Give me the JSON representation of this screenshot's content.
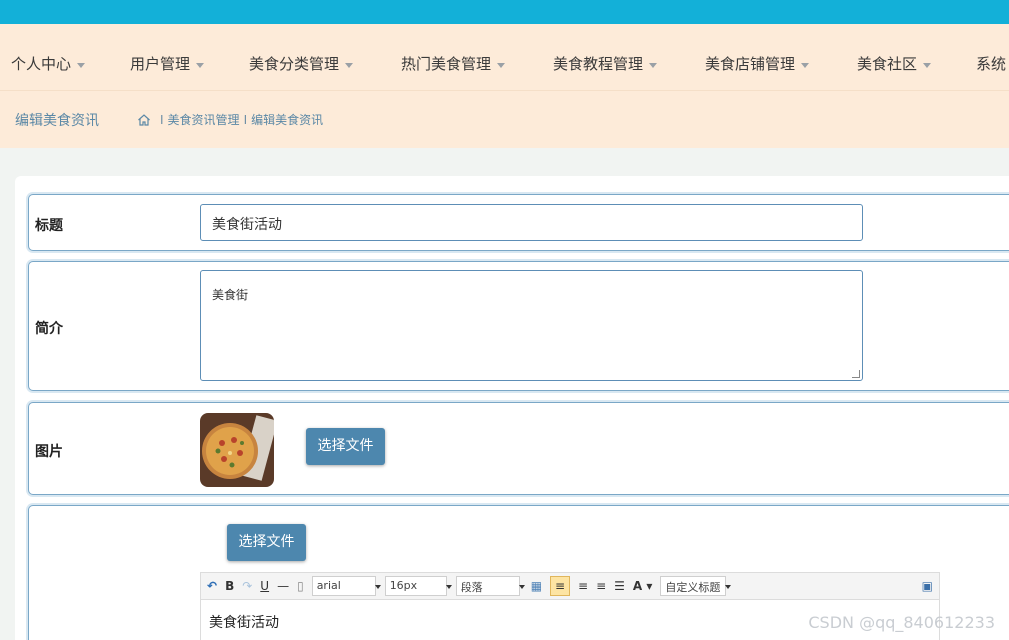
{
  "nav": {
    "items": [
      {
        "label": "个人中心"
      },
      {
        "label": "用户管理"
      },
      {
        "label": "美食分类管理"
      },
      {
        "label": "热门美食管理"
      },
      {
        "label": "美食教程管理"
      },
      {
        "label": "美食店铺管理"
      },
      {
        "label": "美食社区"
      },
      {
        "label": "系统"
      }
    ]
  },
  "breadcrumb": {
    "title": "编辑美食资讯",
    "path": [
      "美食资讯管理",
      "编辑美食资讯"
    ]
  },
  "form": {
    "title_label": "标题",
    "title_value": "美食街活动",
    "intro_label": "简介",
    "intro_value": "美食街",
    "image_label": "图片",
    "image_button": "选择文件",
    "content_button": "选择文件"
  },
  "editor": {
    "font": "arial",
    "size": "16px",
    "paragraph": "段落",
    "custom_title": "自定义标题",
    "content": "美食街活动"
  },
  "watermark": "CSDN @qq_840612233",
  "colors": {
    "topbar": "#13b0d8",
    "nav_bg": "#fdebd9",
    "button": "#4d87ae",
    "border": "#7aa7c7"
  }
}
